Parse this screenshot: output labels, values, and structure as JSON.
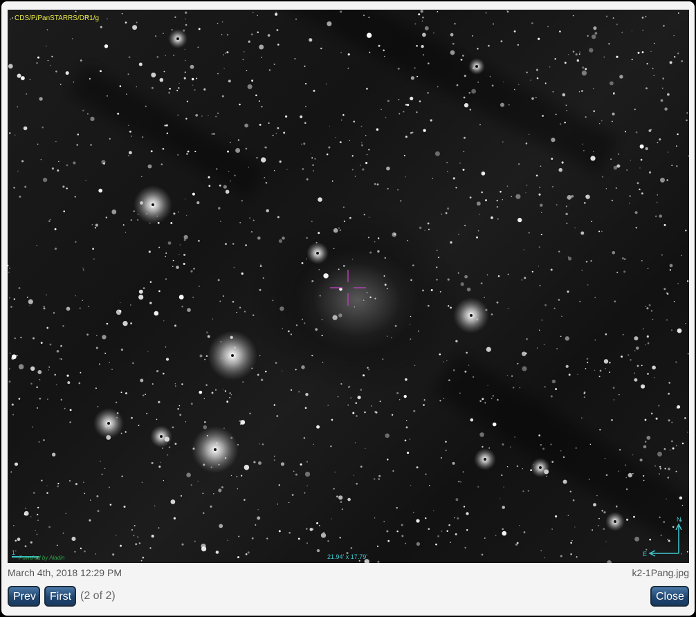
{
  "viewer": {
    "survey_label": "CDS/P/PanSTARRS/DR1/g",
    "fov_label": "21.94' x 17.79'",
    "scale_label": "1'",
    "credit": "Powered by Aladin",
    "compass_n": "N",
    "compass_e": "E"
  },
  "caption": {
    "date": "March 4th, 2018 12:29 PM",
    "filename": "k2-1Pang.jpg"
  },
  "controls": {
    "prev_label": "Prev",
    "first_label": "First",
    "counter": "(2 of 2)",
    "close_label": "Close"
  },
  "colors": {
    "survey_label": "#e8e84a",
    "overlay": "#40c8d0",
    "reticle": "#b040b0",
    "button_top": "#4a78a8",
    "button_bottom": "#173a60"
  }
}
